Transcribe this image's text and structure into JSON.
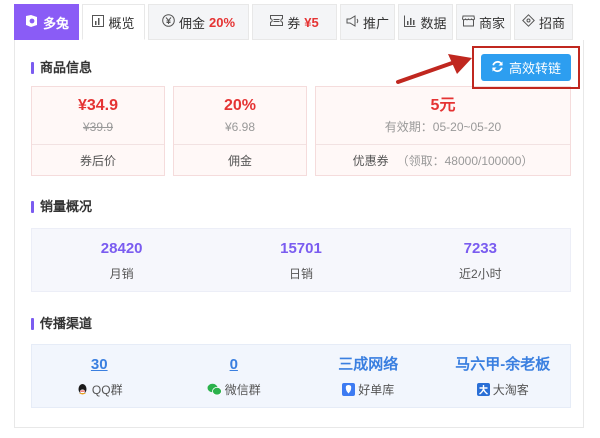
{
  "tabs": [
    {
      "id": "brand",
      "label": "多兔",
      "icon": "duotu-logo-icon",
      "highlight": ""
    },
    {
      "id": "overview",
      "label": "概览",
      "icon": "chart-icon",
      "highlight": ""
    },
    {
      "id": "commission",
      "label": "佣金",
      "icon": "yen-icon",
      "highlight": "20%"
    },
    {
      "id": "coupon",
      "label": "券",
      "icon": "ticket-icon",
      "highlight": "¥5"
    },
    {
      "id": "promote",
      "label": "推广",
      "icon": "megaphone-icon",
      "highlight": ""
    },
    {
      "id": "data",
      "label": "数据",
      "icon": "bar-chart-icon",
      "highlight": ""
    },
    {
      "id": "merchant",
      "label": "商家",
      "icon": "shop-icon",
      "highlight": ""
    },
    {
      "id": "recruit",
      "label": "招商",
      "icon": "tag-icon",
      "highlight": ""
    }
  ],
  "convert_button": {
    "label": "高效转链",
    "icon": "refresh-icon"
  },
  "sections": {
    "product": "商品信息",
    "sales": "销量概况",
    "channels": "传播渠道"
  },
  "product": {
    "price": {
      "value": "¥34.9",
      "original": "¥39.9",
      "label": "券后价"
    },
    "commission": {
      "value": "20%",
      "amount": "¥6.98",
      "label": "佣金"
    },
    "coupon": {
      "value": "5元",
      "validity": "有效期：05-20~05-20",
      "label": "优惠券",
      "claimed": "（领取：48000/100000）"
    }
  },
  "sales": [
    {
      "value": "28420",
      "label": "月销"
    },
    {
      "value": "15701",
      "label": "日销"
    },
    {
      "value": "7233",
      "label": "近2小时"
    }
  ],
  "channels": [
    {
      "value": "30",
      "label": "QQ群",
      "icon": "qq-icon",
      "color": "#1a1a1a"
    },
    {
      "value": "0",
      "label": "微信群",
      "icon": "wechat-icon",
      "color": "#2bb24c"
    },
    {
      "value": "三成网络",
      "label": "好单库",
      "icon": "haodanku-icon",
      "color": "#3d7bf2"
    },
    {
      "value": "马六甲-余老板",
      "label": "大淘客",
      "icon": "dataoke-icon",
      "color": "#2a6fd6"
    }
  ],
  "colors": {
    "brand": "#8a5cf6",
    "price": "#e53333",
    "stat": "#7a5cf0",
    "link": "#3a7fe0",
    "button": "#2d9ef0",
    "highlight": "#c0271f"
  }
}
